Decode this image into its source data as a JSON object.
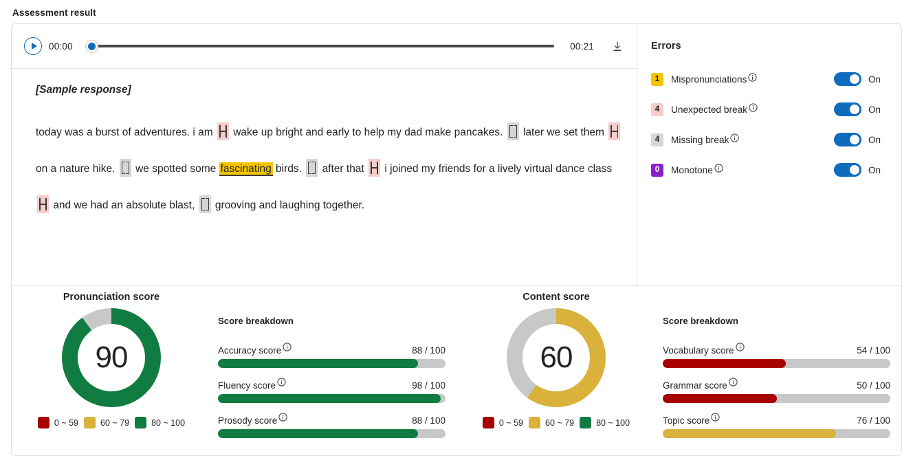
{
  "page": {
    "title": "Assessment result"
  },
  "colors": {
    "accent_blue": "#0f6cbd",
    "green": "#107c41",
    "gold": "#d9b13b",
    "dark_red": "#a80000",
    "track_gray": "#c8c8c8",
    "mispron_badge": "#f5c400",
    "unexpected_badge": "#f6cdcd",
    "missing_badge": "#d6d6d6",
    "monotone_badge": "#8b20c8"
  },
  "player": {
    "play_label": "play-button",
    "current_time": "00:00",
    "total_time": "00:21",
    "progress_percent": 0,
    "download_label": "download"
  },
  "transcript": {
    "sample_label": "[Sample response]",
    "lines": [
      "today was a burst of adventures. i am",
      "wake up bright and early to help my dad make pancakes.",
      "later we set them",
      "on a nature hike.",
      "we spotted some",
      "fascinating",
      "birds.",
      "after that",
      "i joined my friends for a lively virtual dance class",
      "and we had an absolute blast,",
      "grooving and laughing together."
    ],
    "mispronounced_word": "fascinating"
  },
  "errors": {
    "title": "Errors",
    "items": [
      {
        "count": "1",
        "label": "Mispronunciations",
        "state": "On",
        "badge_color": "#f5c400",
        "badge_text_color": "#242424"
      },
      {
        "count": "4",
        "label": "Unexpected break",
        "state": "On",
        "badge_color": "#f6cdcd",
        "badge_text_color": "#242424"
      },
      {
        "count": "4",
        "label": "Missing break",
        "state": "On",
        "badge_color": "#d6d6d6",
        "badge_text_color": "#242424"
      },
      {
        "count": "0",
        "label": "Monotone",
        "state": "On",
        "badge_color": "#8b20c8",
        "badge_text_color": "#ffffff"
      }
    ]
  },
  "legend": {
    "items": [
      {
        "label": "0 ~ 59",
        "color": "#a80000"
      },
      {
        "label": "60 ~ 79",
        "color": "#d9b13b"
      },
      {
        "label": "80 ~ 100",
        "color": "#107c41"
      }
    ]
  },
  "pronunciation": {
    "heading": "Pronunciation score",
    "score": "90",
    "score_value": 90,
    "arc_color": "#107c41",
    "breakdown_title": "Score breakdown",
    "rows": [
      {
        "name": "Accuracy score",
        "value": "88 / 100",
        "percent": 88,
        "color": "#107c41"
      },
      {
        "name": "Fluency score",
        "value": "98 / 100",
        "percent": 98,
        "color": "#107c41"
      },
      {
        "name": "Prosody score",
        "value": "88 / 100",
        "percent": 88,
        "color": "#107c41"
      }
    ]
  },
  "content": {
    "heading": "Content score",
    "score": "60",
    "score_value": 60,
    "arc_color": "#d9b13b",
    "breakdown_title": "Score breakdown",
    "rows": [
      {
        "name": "Vocabulary score",
        "value": "54 / 100",
        "percent": 54,
        "color": "#a80000"
      },
      {
        "name": "Grammar score",
        "value": "50 / 100",
        "percent": 50,
        "color": "#a80000"
      },
      {
        "name": "Topic score",
        "value": "76 / 100",
        "percent": 76,
        "color": "#d9b13b"
      }
    ]
  },
  "chart_data": [
    {
      "type": "pie",
      "title": "Pronunciation score",
      "labels": [
        "score",
        "remainder"
      ],
      "values": [
        90,
        10
      ],
      "colors": [
        "#107c41",
        "#c8c8c8"
      ],
      "center_label": "90",
      "legend": [
        "0 ~ 59",
        "60 ~ 79",
        "80 ~ 100"
      ]
    },
    {
      "type": "bar",
      "title": "Score breakdown",
      "categories": [
        "Accuracy score",
        "Fluency score",
        "Prosody score"
      ],
      "values": [
        88,
        98,
        88
      ],
      "xlim": [
        0,
        100
      ],
      "ylabel": "",
      "xlabel": ""
    },
    {
      "type": "pie",
      "title": "Content score",
      "labels": [
        "score",
        "remainder"
      ],
      "values": [
        60,
        40
      ],
      "colors": [
        "#d9b13b",
        "#c8c8c8"
      ],
      "center_label": "60",
      "legend": [
        "0 ~ 59",
        "60 ~ 79",
        "80 ~ 100"
      ]
    },
    {
      "type": "bar",
      "title": "Score breakdown",
      "categories": [
        "Vocabulary score",
        "Grammar score",
        "Topic score"
      ],
      "values": [
        54,
        50,
        76
      ],
      "xlim": [
        0,
        100
      ],
      "ylabel": "",
      "xlabel": ""
    }
  ]
}
